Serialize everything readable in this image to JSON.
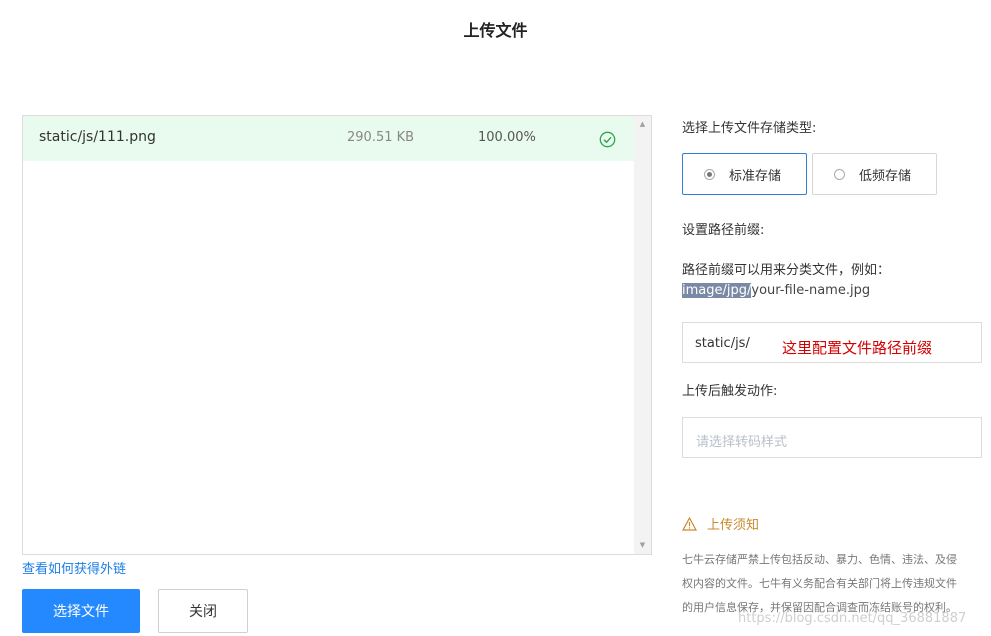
{
  "dialog": {
    "title": "上传文件"
  },
  "file_list": {
    "files": [
      {
        "name": "static/js/111.png",
        "size": "290.51 KB",
        "progress": "100.00%",
        "status": "complete"
      }
    ],
    "scroll_up": "▲",
    "scroll_down": "▼"
  },
  "link": {
    "external_link": "查看如何获得外链"
  },
  "buttons": {
    "choose": "选择文件",
    "close": "关闭"
  },
  "storage": {
    "label": "选择上传文件存储类型:",
    "options": [
      "标准存储",
      "低频存储"
    ],
    "selected": "标准存储"
  },
  "prefix": {
    "label": "设置路径前缀:",
    "hint_line1": "路径前缀可以用来分类文件，例如：",
    "hint_example_highlight": "image/jpg/",
    "hint_example_rest": "your-file-name.jpg",
    "value": "static/js/",
    "annotation": "这里配置文件路径前缀"
  },
  "action": {
    "label": "上传后触发动作:",
    "placeholder": "请选择转码样式"
  },
  "notice": {
    "title": "上传须知",
    "line1": "七牛云存储严禁上传包括反动、暴力、色情、违法、及侵",
    "line2": "权内容的文件。七牛有义务配合有关部门将上传违规文件",
    "line3": "的用户信息保存，并保留因配合调查而冻结账号的权利。"
  },
  "watermark": "https://blog.csdn.net/qq_36881887",
  "colors": {
    "primary": "#2489ff",
    "success_bg": "#e8fbee",
    "success_icon": "#2ea44f",
    "warning": "#c78a2c",
    "annotation": "#d40000"
  }
}
